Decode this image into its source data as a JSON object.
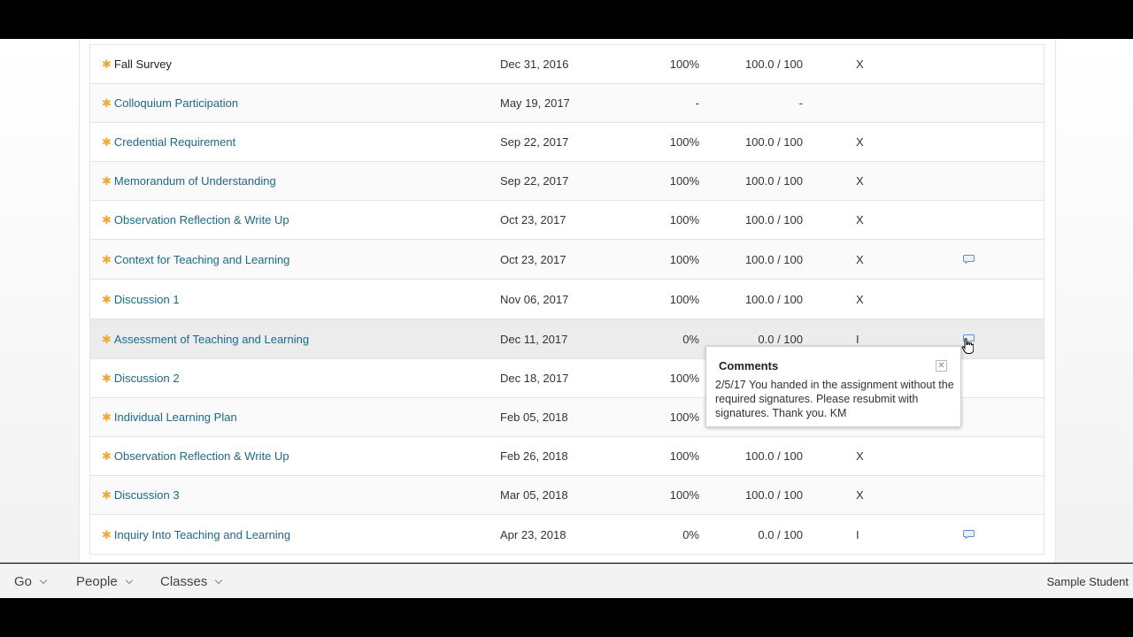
{
  "grades": {
    "rows": [
      {
        "name": "Fall Survey",
        "date": "Dec 31, 2016",
        "percent": "100%",
        "score": "100.0 / 100",
        "flag": "X",
        "link": false,
        "comment": false
      },
      {
        "name": "Colloquium Participation",
        "date": "May 19, 2017",
        "percent": "-",
        "score": "-",
        "flag": "",
        "link": true,
        "comment": false
      },
      {
        "name": "Credential Requirement",
        "date": "Sep 22, 2017",
        "percent": "100%",
        "score": "100.0 / 100",
        "flag": "X",
        "link": true,
        "comment": false
      },
      {
        "name": "Memorandum of Understanding",
        "date": "Sep 22, 2017",
        "percent": "100%",
        "score": "100.0 / 100",
        "flag": "X",
        "link": true,
        "comment": false
      },
      {
        "name": "Observation Reflection & Write Up",
        "date": "Oct 23, 2017",
        "percent": "100%",
        "score": "100.0 / 100",
        "flag": "X",
        "link": true,
        "comment": false
      },
      {
        "name": "Context for Teaching and Learning",
        "date": "Oct 23, 2017",
        "percent": "100%",
        "score": "100.0 / 100",
        "flag": "X",
        "link": true,
        "comment": true
      },
      {
        "name": "Discussion 1",
        "date": "Nov 06, 2017",
        "percent": "100%",
        "score": "100.0 / 100",
        "flag": "X",
        "link": true,
        "comment": false
      },
      {
        "name": "Assessment of Teaching and Learning",
        "date": "Dec 11, 2017",
        "percent": "0%",
        "score": "0.0 / 100",
        "flag": "I",
        "link": true,
        "comment": true
      },
      {
        "name": "Discussion 2",
        "date": "Dec 18, 2017",
        "percent": "100%",
        "score": "",
        "flag": "",
        "link": true,
        "comment": false
      },
      {
        "name": "Individual Learning Plan",
        "date": "Feb 05, 2018",
        "percent": "100%",
        "score": "",
        "flag": "",
        "link": true,
        "comment": false
      },
      {
        "name": "Observation Reflection & Write Up",
        "date": "Feb 26, 2018",
        "percent": "100%",
        "score": "100.0 / 100",
        "flag": "X",
        "link": true,
        "comment": false
      },
      {
        "name": "Discussion 3",
        "date": "Mar 05, 2018",
        "percent": "100%",
        "score": "100.0 / 100",
        "flag": "X",
        "link": true,
        "comment": false
      },
      {
        "name": "Inquiry Into Teaching and Learning",
        "date": "Apr 23, 2018",
        "percent": "0%",
        "score": "0.0 / 100",
        "flag": "I",
        "link": true,
        "comment": true
      }
    ]
  },
  "comment_popup": {
    "title": "Comments",
    "close_icon": "close-icon",
    "body": "2/5/17 You handed in the assignment without the required signatures. Please resubmit with signatures. Thank you. KM"
  },
  "bottom_bar": {
    "go_label": "Go",
    "people_label": "People",
    "classes_label": "Classes",
    "user_name": "Sample Student"
  },
  "colors": {
    "link": "#1a6a8e",
    "star": "#f0a830",
    "comment_icon": "#5b8fd6"
  }
}
